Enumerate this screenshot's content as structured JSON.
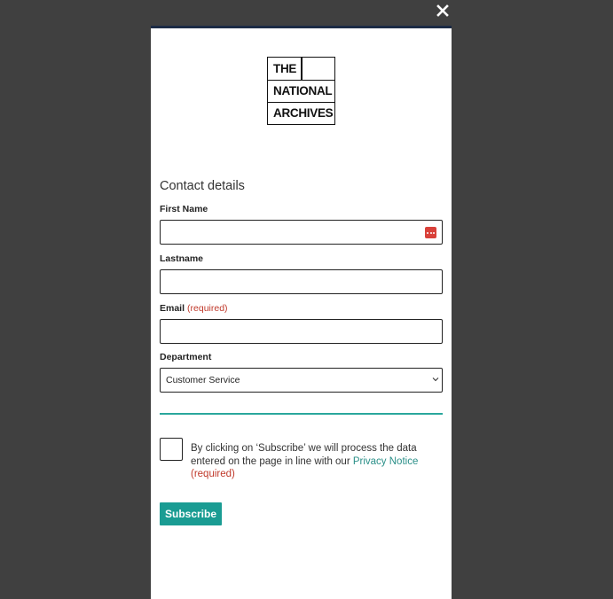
{
  "logo": {
    "line1": "THE",
    "line2": "NATIONAL",
    "line3": "ARCHIVES"
  },
  "form": {
    "heading": "Contact details",
    "first_name": {
      "label": "First Name",
      "value": "",
      "placeholder": ""
    },
    "lastname": {
      "label": "Lastname",
      "value": "",
      "placeholder": ""
    },
    "email": {
      "label": "Email",
      "required_text": "(required)",
      "value": "",
      "placeholder": ""
    },
    "department": {
      "label": "Department",
      "selected": "Customer Service"
    },
    "consent": {
      "text_before": "By clicking on ‘Subscribe’ we will process the data entered on the page in line with our ",
      "link_text": "Privacy Notice",
      "required_text": "(required)",
      "checked": false
    },
    "subscribe_label": "Subscribe"
  },
  "colors": {
    "overlay": "#404040",
    "accent": "#1a9c93",
    "required": "#c0392b",
    "modal_top_border": "#1c2b45"
  },
  "icons": {
    "close": "close-icon",
    "password_manager": "password-manager-icon",
    "select_chevron": "chevron-down-icon"
  }
}
